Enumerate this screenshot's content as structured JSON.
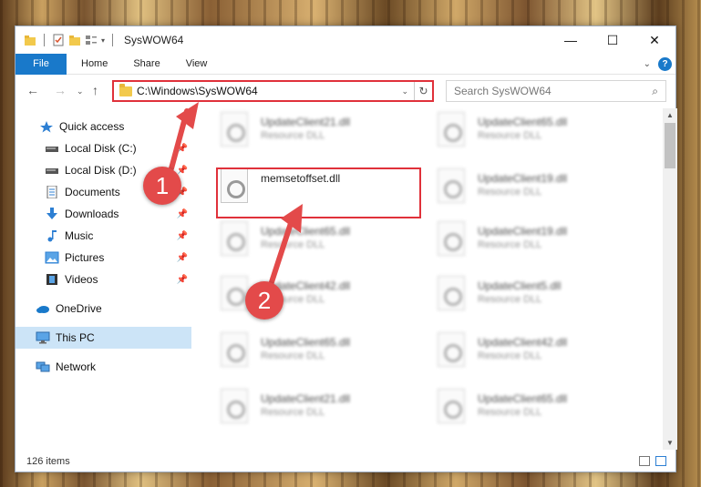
{
  "window": {
    "title": "SysWOW64",
    "controls": {
      "minimize": "—",
      "maximize": "☐",
      "close": "✕"
    }
  },
  "ribbon": {
    "tabs": [
      "File",
      "Home",
      "Share",
      "View"
    ]
  },
  "address": {
    "path": "C:\\Windows\\SysWOW64",
    "search_placeholder": "Search SysWOW64"
  },
  "sidebar": {
    "items": [
      {
        "label": "Quick access",
        "icon": "star-icon"
      },
      {
        "label": "Local Disk (C:)",
        "icon": "drive-icon",
        "pinned": true
      },
      {
        "label": "Local Disk (D:)",
        "icon": "drive-icon",
        "pinned": true
      },
      {
        "label": "Documents",
        "icon": "documents-icon",
        "pinned": true
      },
      {
        "label": "Downloads",
        "icon": "download-arrow-icon",
        "pinned": true
      },
      {
        "label": "Music",
        "icon": "music-note-icon",
        "pinned": true
      },
      {
        "label": "Pictures",
        "icon": "pictures-icon",
        "pinned": true
      },
      {
        "label": "Videos",
        "icon": "film-icon",
        "pinned": true
      },
      {
        "label": "OneDrive",
        "icon": "cloud-icon"
      },
      {
        "label": "This PC",
        "icon": "monitor-icon",
        "selected": true
      },
      {
        "label": "Network",
        "icon": "network-icon"
      }
    ]
  },
  "files": {
    "type_label": "Resource DLL",
    "items": [
      {
        "name": "UpdateClient21.dll",
        "blurred": true
      },
      {
        "name": "UpdateClient65.dll",
        "blurred": true
      },
      {
        "name": "memsetoffset.dll",
        "blurred": false
      },
      {
        "name": "UpdateClient19.dll",
        "blurred": true
      },
      {
        "name": "UpdateClient65.dll",
        "blurred": true
      },
      {
        "name": "UpdateClient19.dll",
        "blurred": true
      },
      {
        "name": "UpdateClient42.dll",
        "blurred": true
      },
      {
        "name": "UpdateClient5.dll",
        "blurred": true
      },
      {
        "name": "UpdateClient65.dll",
        "blurred": true
      },
      {
        "name": "UpdateClient42.dll",
        "blurred": true
      },
      {
        "name": "UpdateClient21.dll",
        "blurred": true
      },
      {
        "name": "UpdateClient65.dll",
        "blurred": true
      }
    ]
  },
  "status": {
    "item_count": "126 items"
  },
  "annotations": {
    "badge1": "1",
    "badge2": "2",
    "color": "#e34a4a"
  }
}
